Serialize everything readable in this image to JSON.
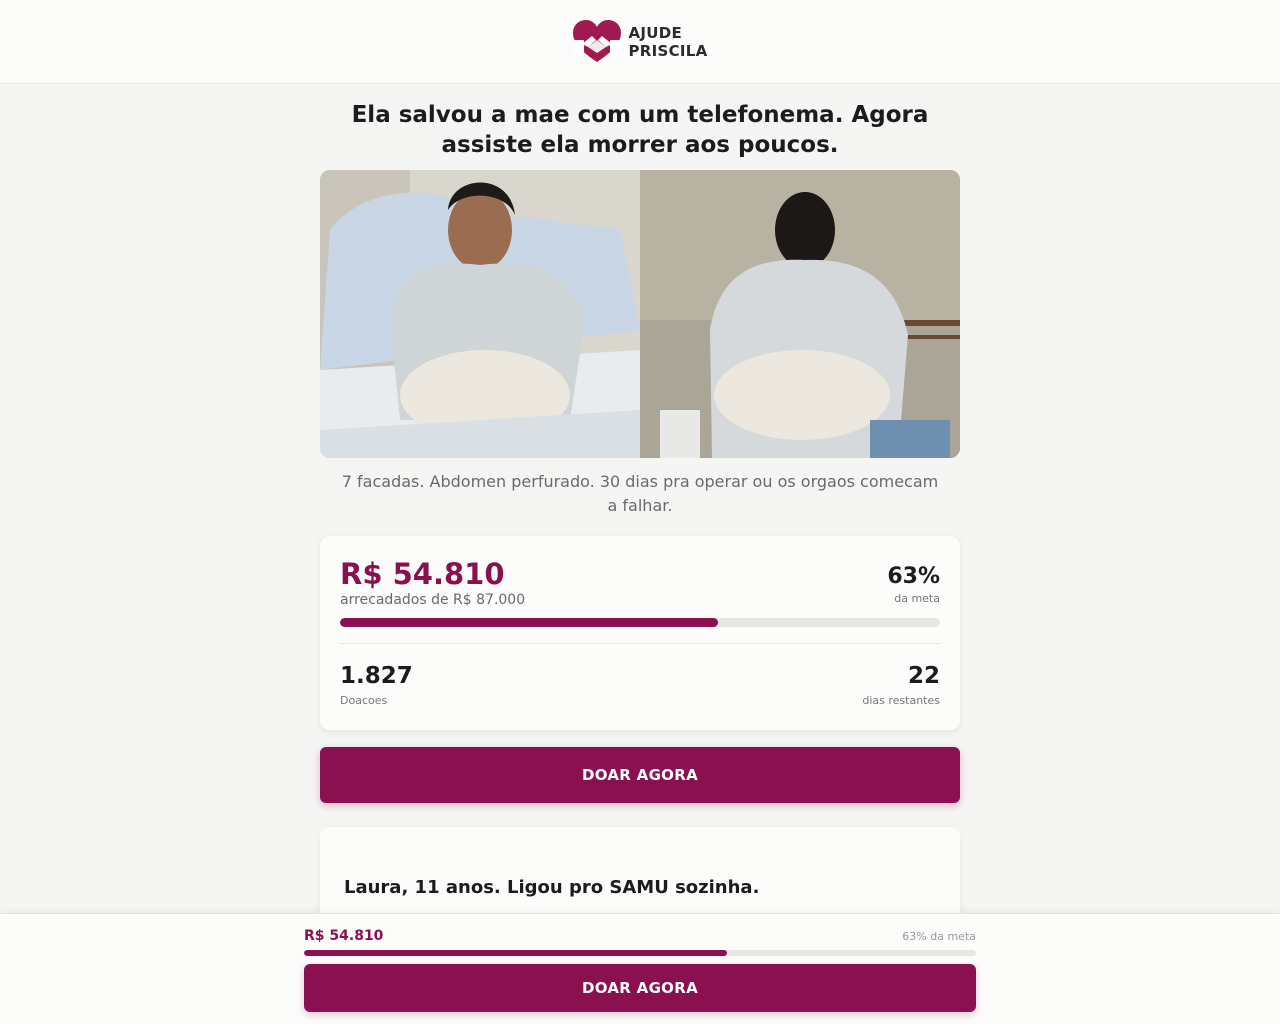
{
  "header": {
    "logo_line1": "AJUDE",
    "logo_line2": "PRISCILA",
    "logo_icon": "heart-hands-icon"
  },
  "headline": "Ela salvou a mae com um telefonema. Agora assiste ela morrer aos poucos.",
  "photos": [
    {
      "icon": "patient-front-photo"
    },
    {
      "icon": "patient-back-photo"
    }
  ],
  "caption": "7 facadas. Abdomen perfurado. 30 dias pra operar ou os orgaos comecam a falhar.",
  "progress": {
    "raised": "R$ 54.810",
    "raised_sub": "arrecadados de R$ 87.000",
    "percent_label": "63%",
    "percent_sub": "da meta",
    "fraction": 0.63
  },
  "stats": {
    "donations_value": "1.827",
    "donations_label": "Doacoes",
    "days_value": "22",
    "days_label": "dias restantes"
  },
  "donate_label": "DOAR AGORA",
  "story": {
    "title": "Laura, 11 anos. Ligou pro SAMU sozinha."
  },
  "sticky": {
    "amount": "R$ 54.810",
    "percent_text": "63% da meta",
    "fraction": 0.63,
    "button_label": "DOAR AGORA"
  },
  "colors": {
    "brand": "#8a1050",
    "background": "#f5f5f3"
  }
}
